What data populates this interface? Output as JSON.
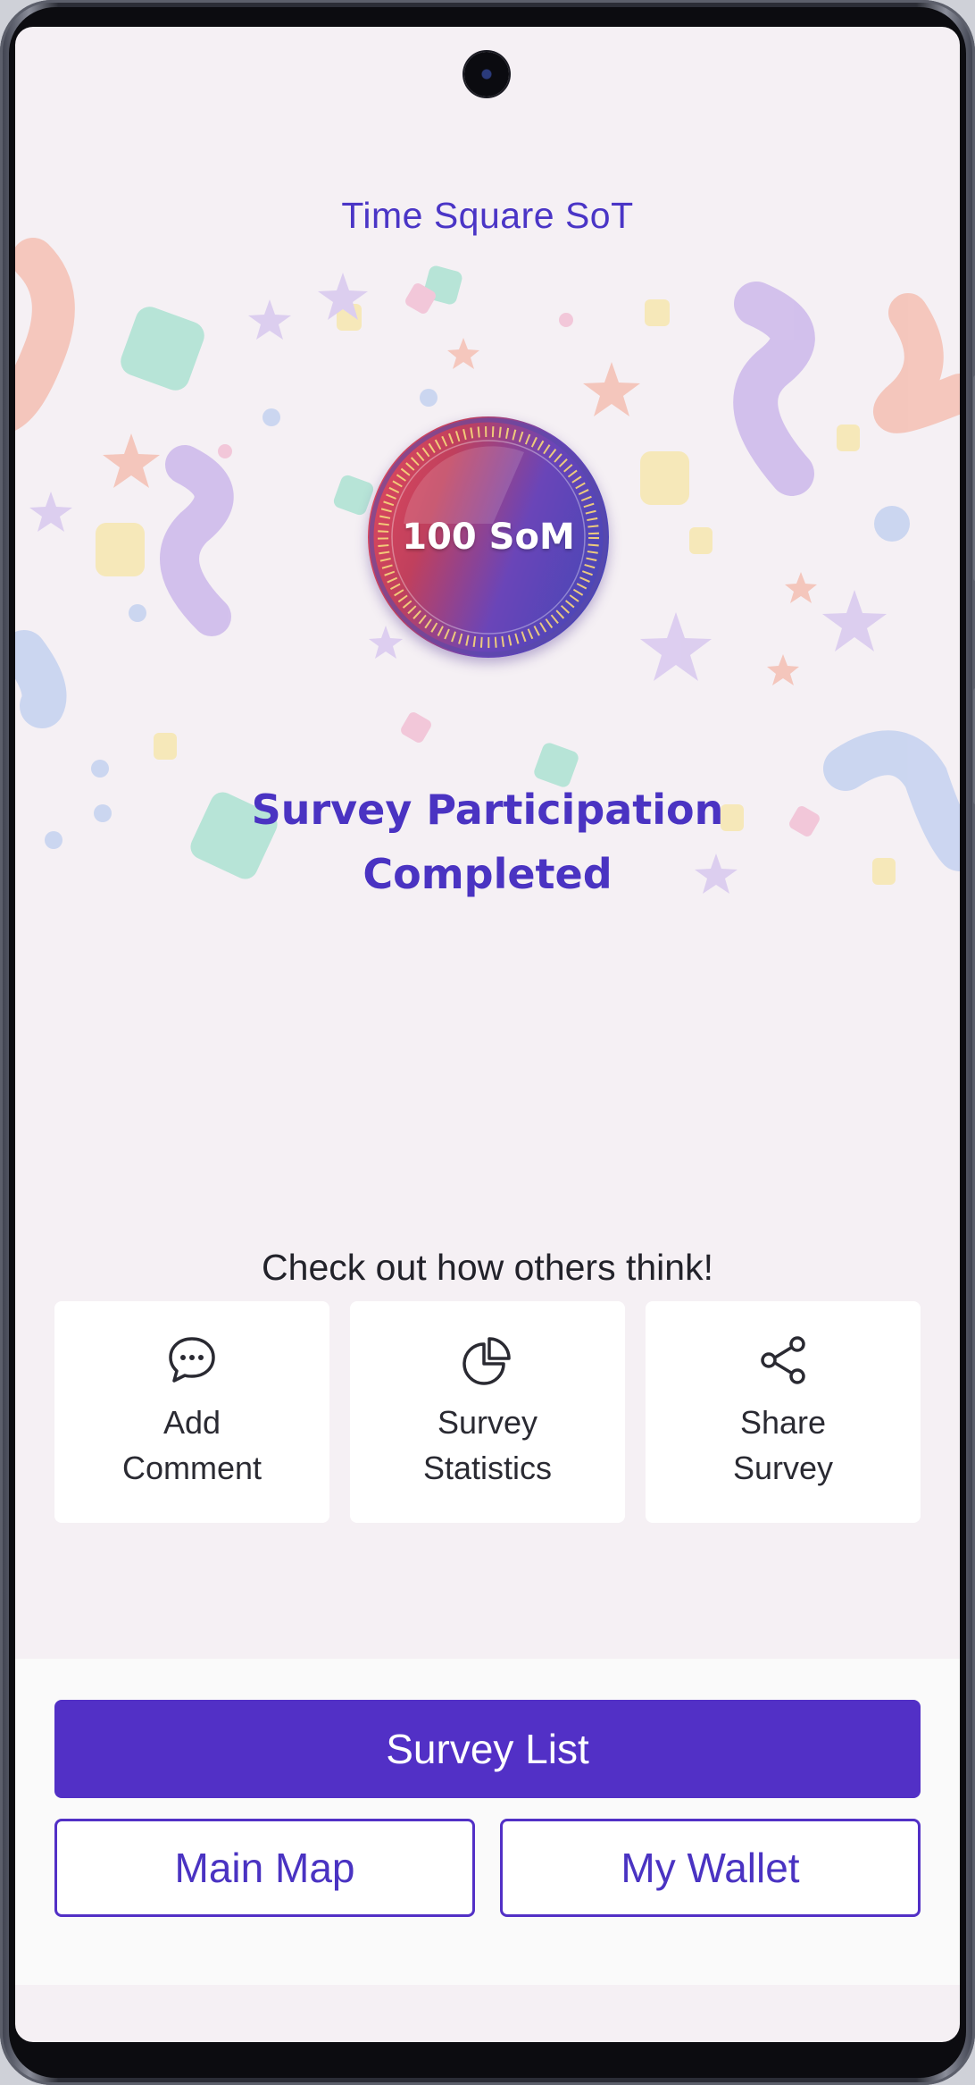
{
  "header": {
    "title": "Time Square SoT"
  },
  "reward": {
    "coin_label": "100 SoM"
  },
  "completion": {
    "line1": "Survey Participation",
    "line2": "Completed"
  },
  "actions": {
    "prompt": "Check out how others think!",
    "items": [
      {
        "label": "Add\nComment",
        "icon": "comment-icon"
      },
      {
        "label": "Survey\nStatistics",
        "icon": "pie-chart-icon"
      },
      {
        "label": "Share\nSurvey",
        "icon": "share-icon"
      }
    ]
  },
  "buttons": {
    "survey_list": "Survey List",
    "main_map": "Main Map",
    "my_wallet": "My Wallet"
  },
  "colors": {
    "accent": "#5230c6",
    "headline": "#4a33c2",
    "background": "#f5f0f4"
  }
}
